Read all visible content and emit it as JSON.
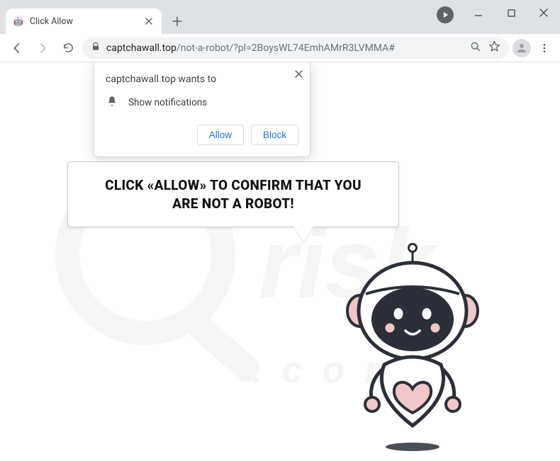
{
  "window": {
    "tab_title": "Click Allow",
    "favicon_glyph": "🤖"
  },
  "toolbar": {
    "url_host": "captchawall.top",
    "url_path": "/not-a-robot/?pl=2BoysWL74EmhAMrR3LVMMA#"
  },
  "permission_prompt": {
    "origin_wants_to": "captchawall.top wants to",
    "permission_label": "Show notifications",
    "allow": "Allow",
    "block": "Block"
  },
  "page": {
    "bubble_line1": "CLICK «ALLOW» TO CONFIRM THAT YOU",
    "bubble_line2": "ARE NOT A ROBOT!"
  },
  "colors": {
    "robot_pink": "#f2c6c6",
    "robot_dark": "#2a2f39",
    "link_blue": "#1a73e8"
  }
}
